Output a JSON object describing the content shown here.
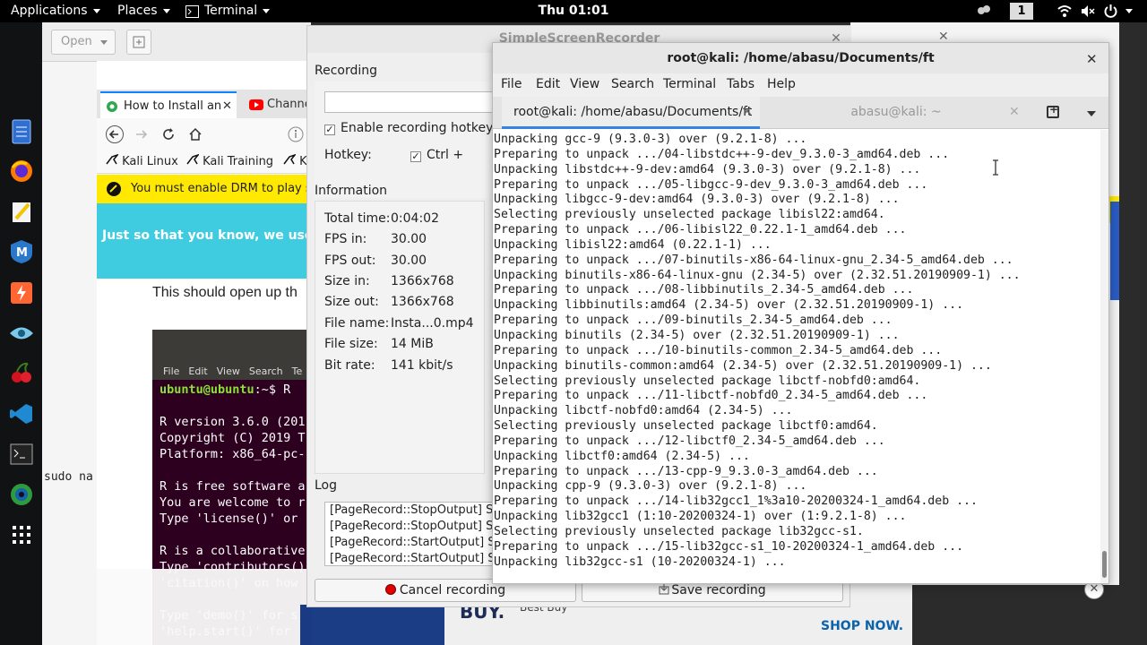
{
  "topbar": {
    "applications": "Applications",
    "places": "Places",
    "terminal": "Terminal",
    "clock": "Thu 01:01",
    "workspace": "1"
  },
  "file_manager": {
    "open_label": "Open",
    "terminal_cmd": "sudo na"
  },
  "browser": {
    "tabs": [
      {
        "label": "How to Install an"
      },
      {
        "label": "Channe"
      }
    ],
    "bookmarks": [
      "Kali Linux",
      "Kali Training",
      "K"
    ],
    "drm_message": "You must enable DRM to play so",
    "cookie_message": "Just so that you know, we use",
    "article_text": "This should open up th",
    "r_terminal": {
      "menu": [
        "File",
        "Edit",
        "View",
        "Search",
        "Te"
      ],
      "prompt_user": "ubuntu@ubuntu",
      "prompt_rest": ":~$ R",
      "lines": [
        "",
        "R version 3.6.0 (201",
        "Copyright (C) 2019 T",
        "Platform: x86_64-pc-",
        "",
        "R is free software a",
        "You are welcome to r",
        "Type 'license()' or",
        "",
        "R is a collaborative",
        "Type 'contributors()",
        "'citation()' on how",
        "",
        "Type 'demo()' for s",
        "'help.start()' for"
      ]
    }
  },
  "ad": {
    "buy": "BUY.",
    "best_buy": "Best Buy",
    "shop_now": "SHOP NOW."
  },
  "ssr": {
    "title": "SimpleScreenRecorder",
    "recording_heading": "Recording",
    "enable_hotkey_label": "Enable recording hotkey",
    "hotkey_label": "Hotkey:",
    "hotkey_ctrl": "Ctrl +",
    "information_heading": "Information",
    "info": [
      {
        "label": "Total time:",
        "value": "0:04:02"
      },
      {
        "label": "FPS in:",
        "value": "30.00"
      },
      {
        "label": "FPS out:",
        "value": "30.00"
      },
      {
        "label": "Size in:",
        "value": "1366x768"
      },
      {
        "label": "Size out:",
        "value": "1366x768"
      },
      {
        "label": "File name:",
        "value": "Insta...0.mp4"
      },
      {
        "label": "File size:",
        "value": "14 MiB"
      },
      {
        "label": "Bit rate:",
        "value": "141 kbit/s"
      }
    ],
    "log_heading": "Log",
    "log_lines": [
      "[PageRecord::StopOutput] St",
      "[PageRecord::StopOutput] St",
      "[PageRecord::StartOutput] St",
      "[PageRecord::StartOutput] St"
    ],
    "cancel_label": "Cancel recording",
    "save_label": "Save recording"
  },
  "terminal": {
    "title": "root@kali: /home/abasu/Documents/ft",
    "menu": [
      "File",
      "Edit",
      "View",
      "Search",
      "Terminal",
      "Tabs",
      "Help"
    ],
    "tabs": [
      {
        "label": "root@kali: /home/abasu/Documents/ft"
      },
      {
        "label": "abasu@kali: ~"
      }
    ],
    "lines": [
      "Unpacking gcc-9 (9.3.0-3) over (9.2.1-8) ...",
      "Preparing to unpack .../04-libstdc++-9-dev_9.3.0-3_amd64.deb ...",
      "Unpacking libstdc++-9-dev:amd64 (9.3.0-3) over (9.2.1-8) ...",
      "Preparing to unpack .../05-libgcc-9-dev_9.3.0-3_amd64.deb ...",
      "Unpacking libgcc-9-dev:amd64 (9.3.0-3) over (9.2.1-8) ...",
      "Selecting previously unselected package libisl22:amd64.",
      "Preparing to unpack .../06-libisl22_0.22.1-1_amd64.deb ...",
      "Unpacking libisl22:amd64 (0.22.1-1) ...",
      "Preparing to unpack .../07-binutils-x86-64-linux-gnu_2.34-5_amd64.deb ...",
      "Unpacking binutils-x86-64-linux-gnu (2.34-5) over (2.32.51.20190909-1) ...",
      "Preparing to unpack .../08-libbinutils_2.34-5_amd64.deb ...",
      "Unpacking libbinutils:amd64 (2.34-5) over (2.32.51.20190909-1) ...",
      "Preparing to unpack .../09-binutils_2.34-5_amd64.deb ...",
      "Unpacking binutils (2.34-5) over (2.32.51.20190909-1) ...",
      "Preparing to unpack .../10-binutils-common_2.34-5_amd64.deb ...",
      "Unpacking binutils-common:amd64 (2.34-5) over (2.32.51.20190909-1) ...",
      "Selecting previously unselected package libctf-nobfd0:amd64.",
      "Preparing to unpack .../11-libctf-nobfd0_2.34-5_amd64.deb ...",
      "Unpacking libctf-nobfd0:amd64 (2.34-5) ...",
      "Selecting previously unselected package libctf0:amd64.",
      "Preparing to unpack .../12-libctf0_2.34-5_amd64.deb ...",
      "Unpacking libctf0:amd64 (2.34-5) ...",
      "Preparing to unpack .../13-cpp-9_9.3.0-3_amd64.deb ...",
      "Unpacking cpp-9 (9.3.0-3) over (9.2.1-8) ...",
      "Preparing to unpack .../14-lib32gcc1_1%3a10-20200324-1_amd64.deb ...",
      "Unpacking lib32gcc1 (1:10-20200324-1) over (1:9.2.1-8) ...",
      "Selecting previously unselected package lib32gcc-s1.",
      "Preparing to unpack .../15-lib32gcc-s1_10-20200324-1_amd64.deb ...",
      "Unpacking lib32gcc-s1 (10-20200324-1) ..."
    ]
  },
  "colors": {
    "tab_accent": "#3584e4",
    "record_dot": "#e00000",
    "drm_bar": "#ffe900",
    "cookie_bar": "#3fcbe0"
  }
}
